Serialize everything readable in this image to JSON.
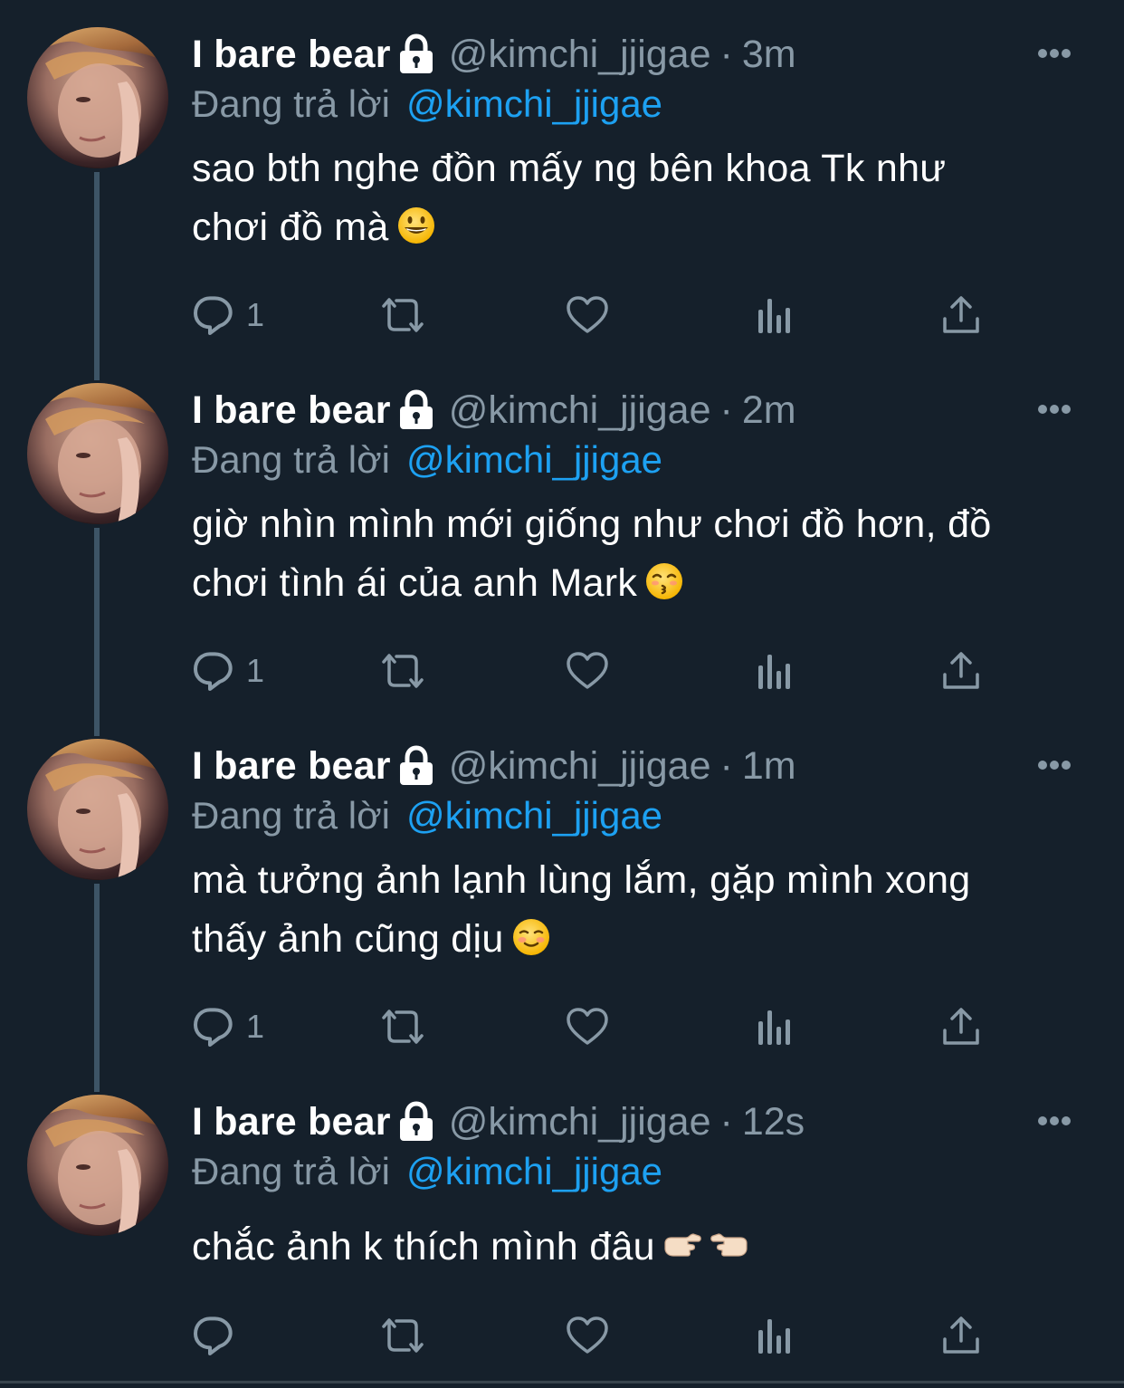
{
  "colors": {
    "background": "#15202b",
    "secondary_text": "#8899a6",
    "link": "#1da1f2",
    "thread_line": "#3d5466"
  },
  "tweets": [
    {
      "display_name": "I bare bear",
      "handle": "@kimchi_jjigae",
      "separator": "·",
      "time": "3m",
      "reply_prefix": "Đang trả lời",
      "reply_to": "@kimchi_jjigae",
      "text_lines": [
        "sao bth nghe đồn mấy ng bên khoa Tk như",
        "chơi đồ mà"
      ],
      "emoji": [
        "grinning-face"
      ],
      "reply_count": "1",
      "icons": [
        "lock-icon",
        "more-icon",
        "reply-icon",
        "retweet-icon",
        "like-icon",
        "analytics-icon",
        "share-icon"
      ]
    },
    {
      "display_name": "I bare bear",
      "handle": "@kimchi_jjigae",
      "separator": "·",
      "time": "2m",
      "reply_prefix": "Đang trả lời",
      "reply_to": "@kimchi_jjigae",
      "text_lines": [
        "giờ nhìn mình mới giống như chơi đồ hơn, đồ",
        "chơi tình ái của anh Mark"
      ],
      "emoji": [
        "kissing-face"
      ],
      "reply_count": "1"
    },
    {
      "display_name": "I bare bear",
      "handle": "@kimchi_jjigae",
      "separator": "·",
      "time": "1m",
      "reply_prefix": "Đang trả lời",
      "reply_to": "@kimchi_jjigae",
      "text_lines": [
        "mà tưởng ảnh lạnh lùng lắm, gặp mình xong",
        "thấy ảnh cũng dịu"
      ],
      "emoji": [
        "smiling-face"
      ],
      "reply_count": "1"
    },
    {
      "display_name": "I bare bear",
      "handle": "@kimchi_jjigae",
      "separator": "·",
      "time": "12s",
      "reply_prefix": "Đang trả lời",
      "reply_to": "@kimchi_jjigae",
      "text_lines": [
        "chắc ảnh k thích mình đâu"
      ],
      "emoji": [
        "pointing-right",
        "pointing-left"
      ],
      "reply_count": ""
    }
  ]
}
